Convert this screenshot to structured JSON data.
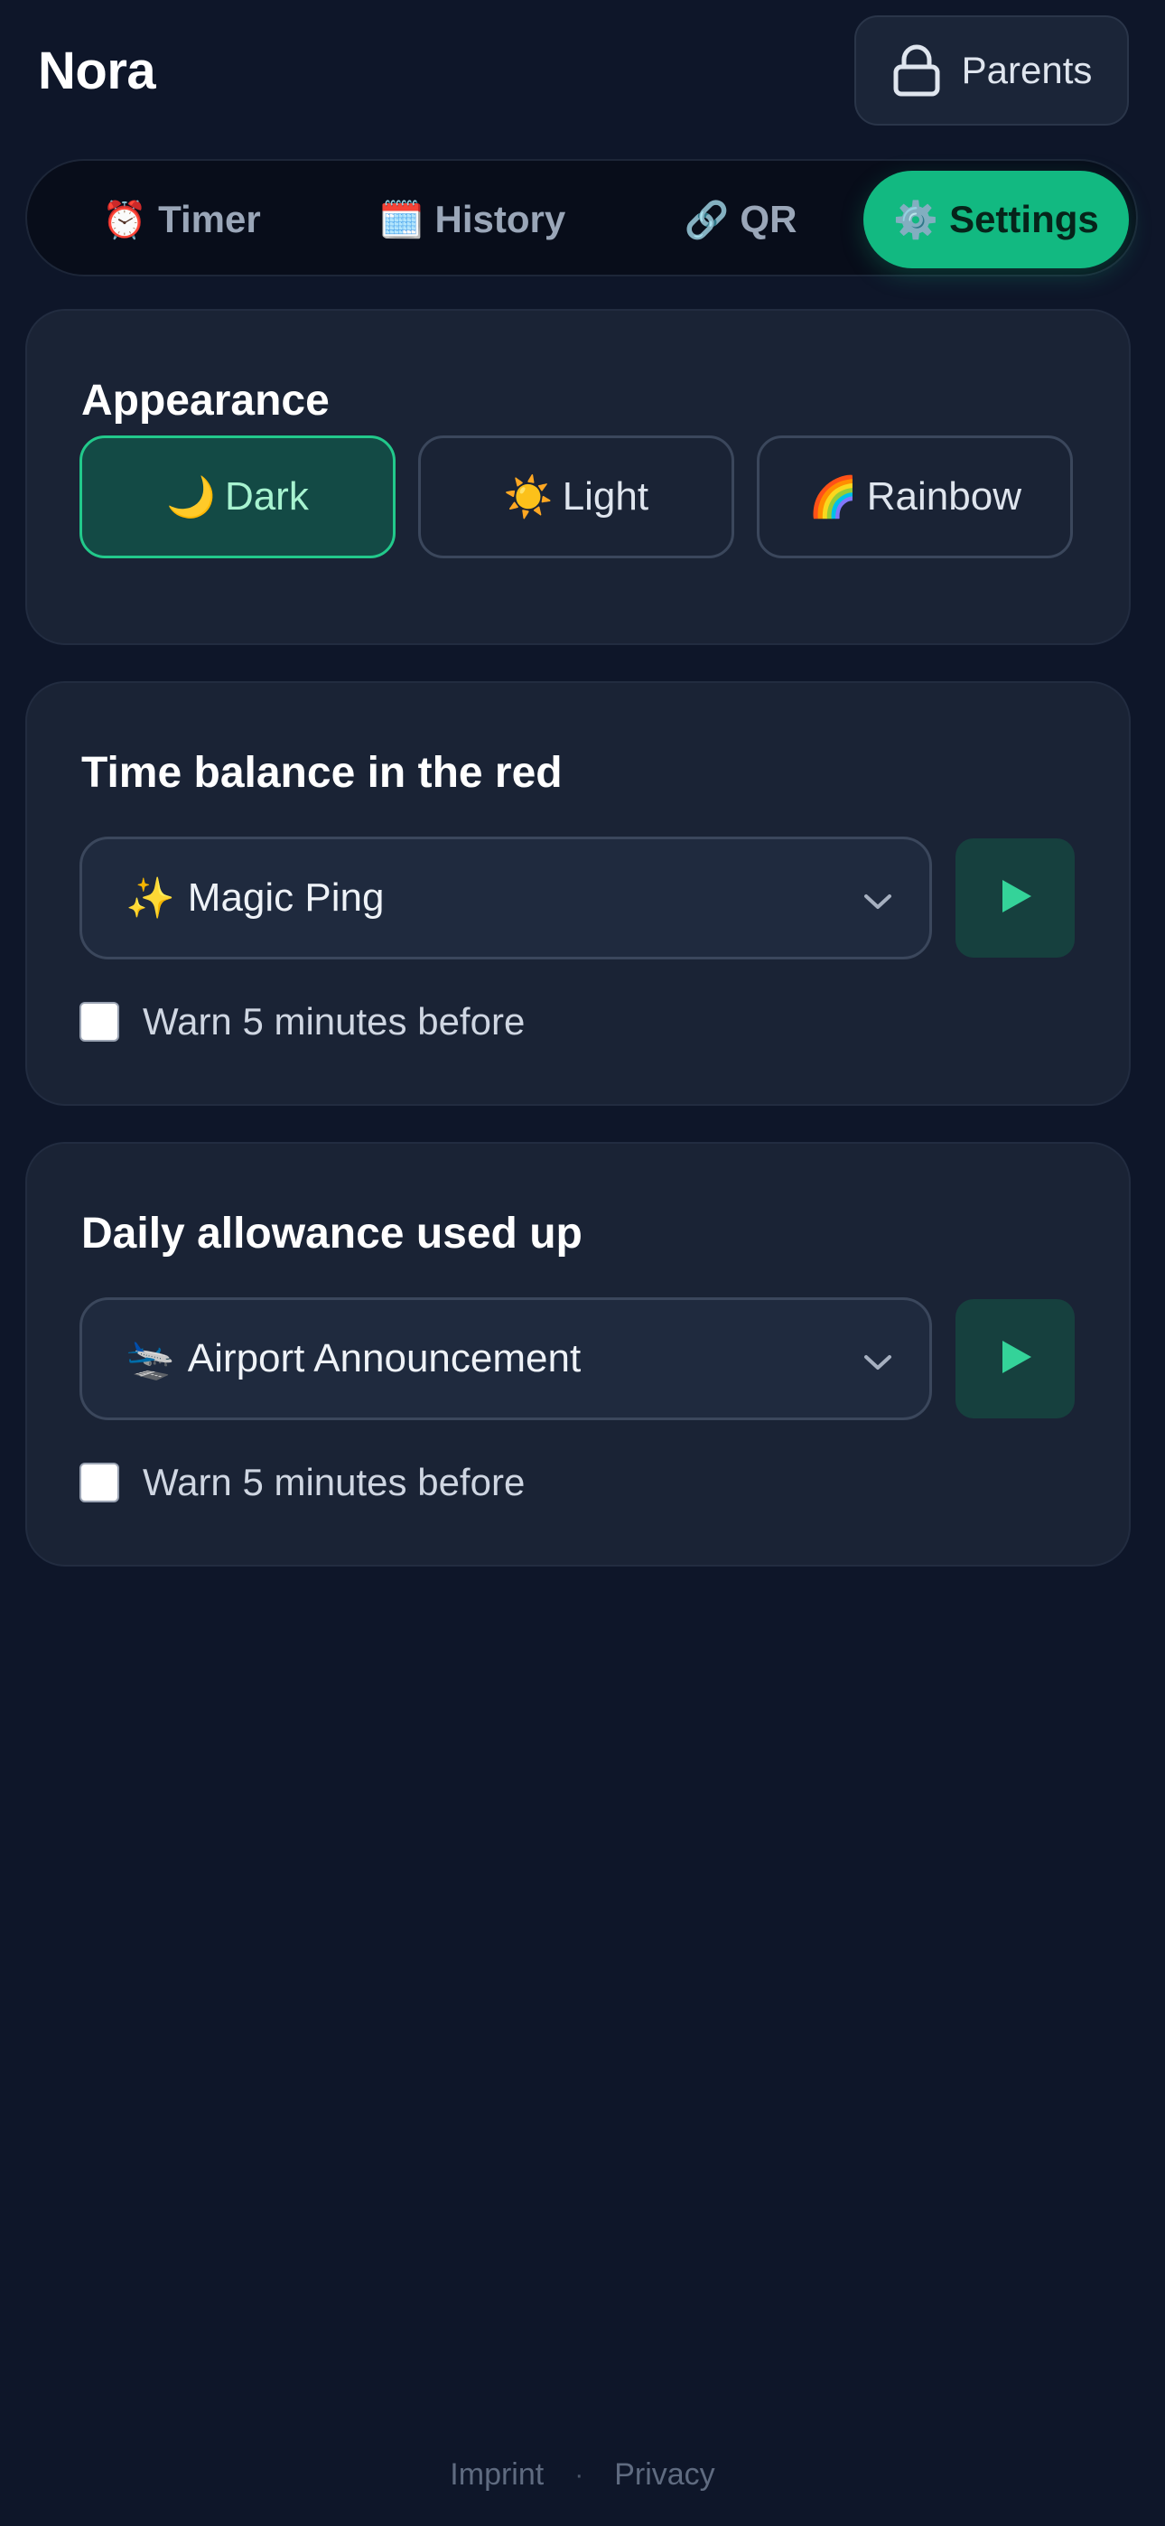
{
  "header": {
    "title": "Nora",
    "parents_label": "Parents",
    "parents_icon": "lock-icon"
  },
  "tabs": [
    {
      "emoji": "⏰",
      "label": "Timer",
      "active": false
    },
    {
      "emoji": "🗓️",
      "label": "History",
      "active": false
    },
    {
      "emoji": "🔗",
      "label": "QR",
      "active": false
    },
    {
      "emoji": "⚙️",
      "label": "Settings",
      "active": true
    }
  ],
  "appearance": {
    "title": "Appearance",
    "options": [
      {
        "emoji": "🌙",
        "label": "Dark",
        "selected": true
      },
      {
        "emoji": "☀️",
        "label": "Light",
        "selected": false
      },
      {
        "emoji": "🌈",
        "label": "Rainbow",
        "selected": false
      }
    ]
  },
  "time_balance": {
    "title": "Time balance in the red",
    "sound_emoji": "✨",
    "sound_label": "Magic Ping",
    "warn_label": "Warn 5 minutes before",
    "warn_checked": false
  },
  "daily_allowance": {
    "title": "Daily allowance used up",
    "sound_emoji": "🛬",
    "sound_label": "Airport Announcement",
    "warn_label": "Warn 5 minutes before",
    "warn_checked": false
  },
  "footer": {
    "imprint": "Imprint",
    "separator": "·",
    "privacy": "Privacy"
  },
  "colors": {
    "background": "#0e1629",
    "card": "#1a2335",
    "accent": "#12b981",
    "accent_dark_bg": "#134a45",
    "play_bg": "#16403e",
    "play_icon": "#34d399"
  }
}
